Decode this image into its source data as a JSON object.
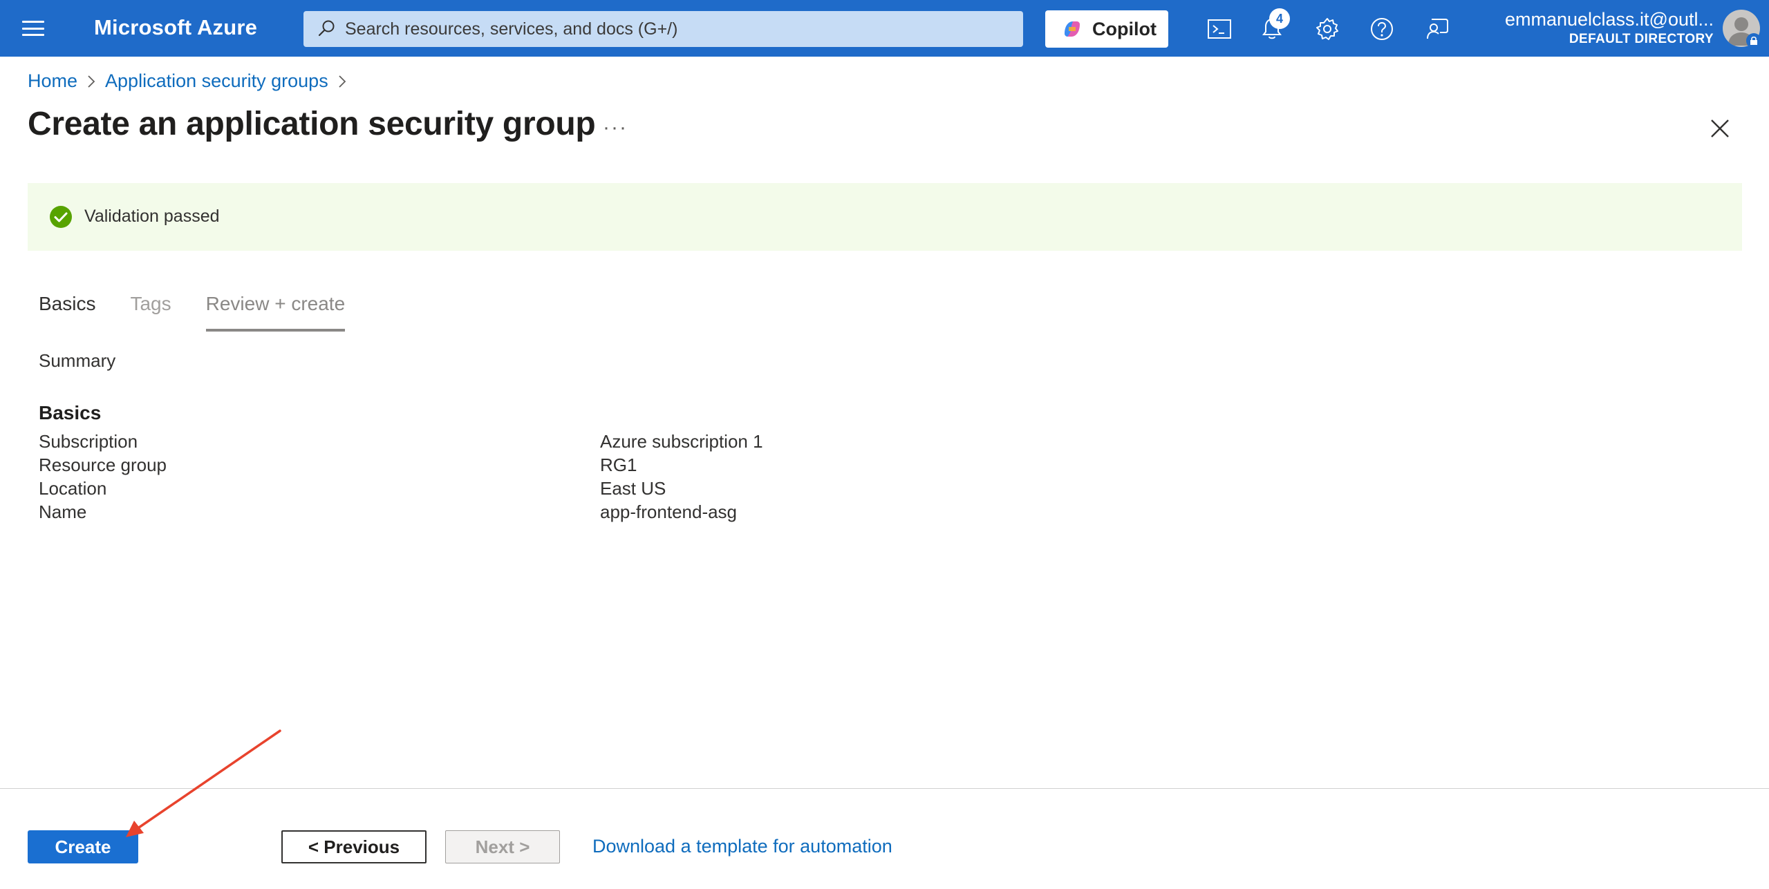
{
  "topbar": {
    "brand": "Microsoft Azure",
    "search_placeholder": "Search resources, services, and docs (G+/)",
    "copilot_label": "Copilot",
    "notification_count": "4",
    "account_email": "emmanuelclass.it@outl...",
    "account_directory": "DEFAULT DIRECTORY"
  },
  "breadcrumb": {
    "home": "Home",
    "parent": "Application security groups"
  },
  "page": {
    "title": "Create an application security group",
    "more": "···"
  },
  "banner": {
    "text": "Validation passed"
  },
  "tabs": {
    "basics": "Basics",
    "tags": "Tags",
    "review": "Review + create"
  },
  "summary": {
    "heading": "Summary",
    "section_title": "Basics",
    "rows": [
      {
        "label": "Subscription",
        "value": "Azure subscription 1"
      },
      {
        "label": "Resource group",
        "value": "RG1"
      },
      {
        "label": "Location",
        "value": "East US"
      },
      {
        "label": "Name",
        "value": "app-frontend-asg"
      }
    ]
  },
  "footer": {
    "create": "Create",
    "previous": "< Previous",
    "next": "Next >",
    "download": "Download a template for automation"
  },
  "colors": {
    "brand_blue": "#1f6bc9",
    "link_blue": "#0f6cbd",
    "success_green": "#57a300",
    "banner_bg": "#f3fbea",
    "annotation_arrow": "#e8432d"
  },
  "icons": {
    "menu": "hamburger-icon",
    "search": "search-icon",
    "copilot": "copilot-logo-icon",
    "cloud_shell": "cloud-shell-icon",
    "notifications": "bell-icon",
    "settings": "gear-icon",
    "help": "help-icon",
    "feedback": "feedback-icon",
    "close": "close-icon",
    "success": "check-circle-icon"
  }
}
